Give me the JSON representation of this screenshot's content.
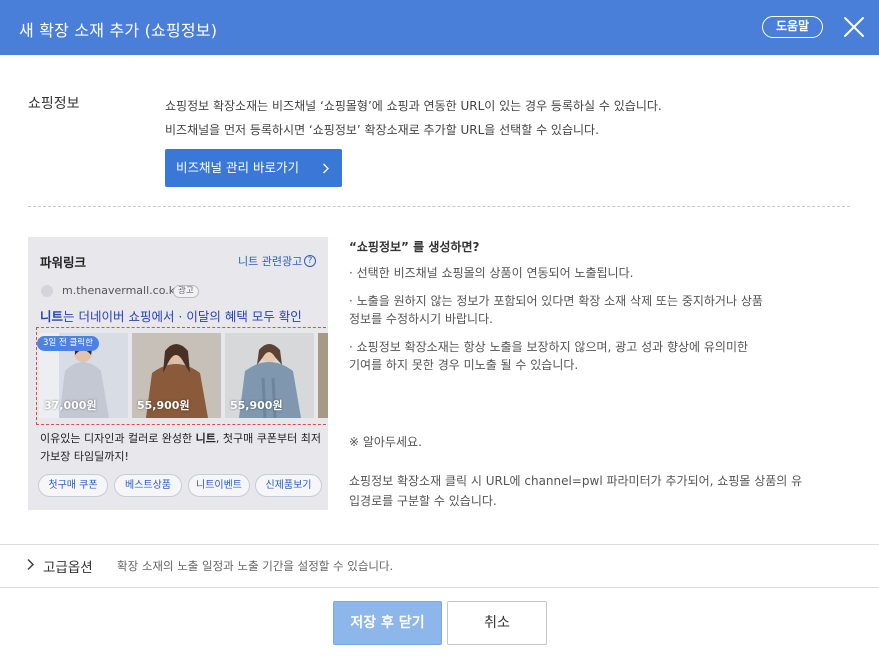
{
  "dialog": {
    "title": "새 확장 소재 추가 (쇼핑정보)",
    "help_label": "도움말"
  },
  "shopping_info": {
    "label": "쇼핑정보",
    "desc_line1": "쇼핑정보 확장소재는 비즈채널 ‘쇼핑몰형’에 쇼핑과 연동한 URL이 있는 경우 등록하실 수 있습니다.",
    "desc_line2": "비즈채널을 먼저 등록하시면 ‘쇼핑정보’ 확장소재로 추가할 URL을 선택할 수 있습니다.",
    "biz_button_label": "비즈채널 관리 바로가기"
  },
  "preview": {
    "title": "파워링크",
    "related_label": "니트 관련광고",
    "url": "m.thenavermall.co.kr",
    "ad_badge": "광고",
    "headline_bold": "니트",
    "headline_rest": "는 더네이버 쇼핑에서 · 이달의 혜택 모두 확인",
    "click_badge": "3일 전 클릭한",
    "products": [
      {
        "price": "37,000원",
        "color": "#cfd3dc"
      },
      {
        "price": "55,900원",
        "color": "#9a6a4c"
      },
      {
        "price": "55,900원",
        "color": "#8da3b8"
      }
    ],
    "body_pre": "이유있는 디자인과 컬러로 완성한 ",
    "body_bold": "니트",
    "body_post": ", 첫구매 쿠폰부터 최저가보장 타임딜까지!",
    "tags": [
      "첫구매 쿠폰",
      "베스트상품",
      "니트이벤트",
      "신제품보기"
    ]
  },
  "info": {
    "title": "“쇼핑정보” 를 생성하면?",
    "bullet1": "· 선택한 비즈채널 쇼핑몰의 상품이 연동되어 노출됩니다.",
    "bullet2_line1": "· 노출을 원하지 않는 정보가 포함되어 있다면 확장 소재 삭제 또는 중지하거나 상품",
    "bullet2_line2": "  정보를 수정하시기 바랍니다.",
    "bullet3_line1": "· 쇼핑정보 확장소재는 항상 노출을 보장하지 않으며, 광고 성과 향상에 유의미한",
    "bullet3_line2": "  기여를 하지 못한 경우 미노출 될 수 있습니다.",
    "notice_title": "※ 알아두세요.",
    "notice_line1": "쇼핑정보 확장소재 클릭 시 URL에 channel=pwl 파라미터가 추가되어, 쇼핑몰 상품의 유",
    "notice_line2": "입경로를 구분할 수 있습니다."
  },
  "advanced": {
    "label": "고급옵션",
    "desc": "확장 소재의 노출 일정과 노출 기간을 설정할 수 있습니다."
  },
  "footer": {
    "save_label": "저장 후 닫기",
    "cancel_label": "취소"
  },
  "colors": {
    "header": "#4a7fd9",
    "primary_button": "#3a78d8",
    "save_disabled": "#8db6ea",
    "preview_bg": "#e8e8ec",
    "highlight_dash": "#e24a4a"
  }
}
